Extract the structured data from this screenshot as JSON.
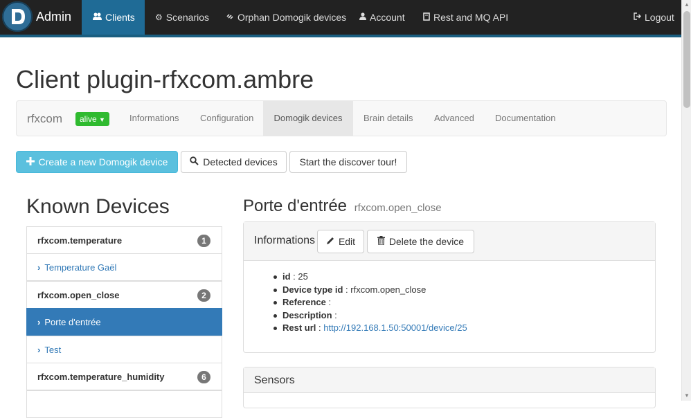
{
  "navbar": {
    "brand": "Admin",
    "items": [
      {
        "label": "Clients",
        "icon": "users-icon"
      },
      {
        "label": "Scenarios",
        "icon": "gear-icon"
      },
      {
        "label": "Orphan Domogik devices",
        "icon": "chain-icon"
      },
      {
        "label": "Account",
        "icon": "user-icon"
      },
      {
        "label": "Rest and MQ API",
        "icon": "book-icon"
      }
    ],
    "logout": "Logout"
  },
  "page": {
    "title": "Client plugin-rfxcom.ambre"
  },
  "subnav": {
    "brand": "rfxcom",
    "status": "alive",
    "tabs": [
      {
        "label": "Informations"
      },
      {
        "label": "Configuration"
      },
      {
        "label": "Domogik devices",
        "active": true
      },
      {
        "label": "Brain details"
      },
      {
        "label": "Advanced"
      },
      {
        "label": "Documentation"
      }
    ],
    "status_color": "#2fba2f"
  },
  "actions": {
    "create": "Create a new Domogik device",
    "detected": "Detected devices",
    "discover": "Start the discover tour!"
  },
  "known_devices": {
    "title": "Known Devices",
    "items": [
      {
        "label": "rfxcom.temperature",
        "type": "group",
        "count": "1"
      },
      {
        "label": "Temperature Gaël",
        "type": "device"
      },
      {
        "label": "rfxcom.open_close",
        "type": "group",
        "count": "2"
      },
      {
        "label": "Porte d'entrée",
        "type": "device",
        "active": true
      },
      {
        "label": "Test",
        "type": "device"
      },
      {
        "label": "rfxcom.temperature_humidity",
        "type": "group",
        "count": "6"
      }
    ]
  },
  "device": {
    "name": "Porte d'entrée",
    "type": "rfxcom.open_close",
    "informations_panel": {
      "title": "Informations",
      "edit": "Edit",
      "delete": "Delete the device",
      "fields": [
        {
          "label": "id",
          "value": "25"
        },
        {
          "label": "Device type id",
          "value": "rfxcom.open_close"
        },
        {
          "label": "Reference",
          "value": ""
        },
        {
          "label": "Description",
          "value": ""
        },
        {
          "label": "Rest url",
          "value": "http://192.168.1.50:50001/device/25",
          "link": true
        }
      ]
    },
    "sensors_panel": {
      "title": "Sensors"
    }
  },
  "colors": {
    "navbar_bg": "#222222",
    "active_blue": "#337ab7",
    "info_button": "#5bc0de"
  }
}
